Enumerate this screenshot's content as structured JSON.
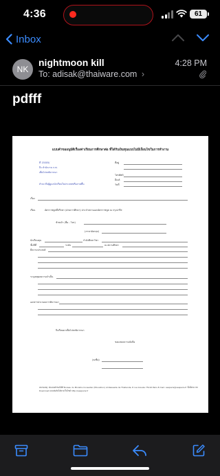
{
  "status": {
    "time": "4:36",
    "battery": "61"
  },
  "nav": {
    "back_label": "Inbox"
  },
  "message": {
    "avatar_initials": "NK",
    "sender": "nightmoon kill",
    "to_prefix": "To:",
    "to_address": "adisak@thaiware.com",
    "time": "4:28 PM",
    "subject": "pdfff"
  },
  "document": {
    "title": "แบบคำขออนุมัติเรื่องค่าเรียนการศึกษาต่อ ที่ได้รับเงินทุนแบบไม่มีเงื่อนไขในการทำงาน",
    "left_header": [
      "ที่ 15005/",
      "ถึง สำนักงาน ก.พ.",
      "เพื่อโปรดพิจารณา",
      "",
      "สำเนาถึงผู้ดูแลนักเรียนในประเทศหรือภาคพื้น"
    ],
    "right_header": [
      "ที่อยู่",
      "",
      "โทรศัพท์",
      "อีเมล์",
      "วันที่"
    ],
    "subject_label": "เรื่อง",
    "to_label": "เรียน",
    "to_text": "อัครราชทูตที่ปรึกษา (ฝ่ายการศึกษา) ประจำสถานเอกอัครราชทูต ณ กรุงปารีส",
    "name_label": "ข้าพเจ้า (ชื่อ - โทร)",
    "passport_label": "(ภาษาอังกฤษ)",
    "study_label": "นักเรียนทุน",
    "study_level": "กำลังศึกษาวิชา",
    "year_label": "ชั้นปีที่",
    "level_label": "ระดับ",
    "school_label": "ณ สถานศึกษา",
    "purpose_label": "มีความประสงค์",
    "reason_label": "ระบุเหตุผลความจำเป็น",
    "docs_label": "เอกสารประกอบการพิจารณา",
    "closing": "จึงเรียนมาเพื่อโปรดพิจารณา",
    "regards": "ขอแสดงความนับถือ",
    "sign_label": "(ลงชื่อ)",
    "footer": "หมายเหตุ: ส่งแบบคำขอได้ที่ Bureau du Ministre Conseiller (Education) Ambassade de Thaïlande, 8 rue Greuze 75116 Paris E-mail: oeaparis@oeaparis.fr ทั้งนี้สามารถ Download แบบฟอร์มได้ทางเว็บไซต์ http://oeaparis.fr"
  },
  "toolbar": {
    "icons": [
      "archive-icon",
      "folder-icon",
      "reply-icon",
      "compose-icon"
    ]
  },
  "colors": {
    "accent": "#3b8cff",
    "toolbar_bg": "#1c1c1e",
    "recording": "#ff2a1f"
  }
}
